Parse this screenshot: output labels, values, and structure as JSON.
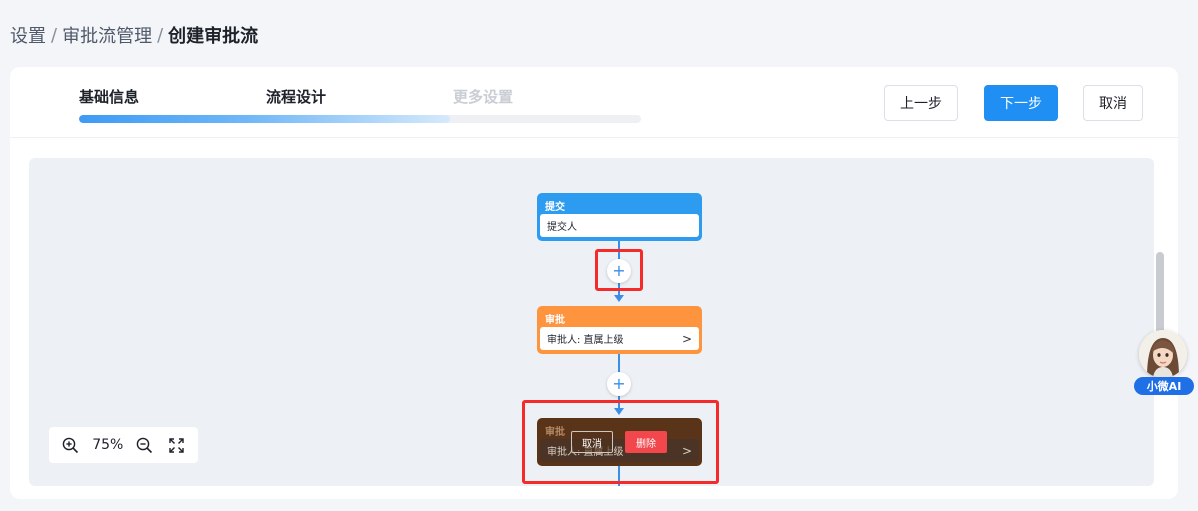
{
  "breadcrumb": {
    "item1": "设置",
    "item2": "审批流管理",
    "current": "创建审批流",
    "separator": "/"
  },
  "steps": [
    {
      "label": "基础信息",
      "state": "done"
    },
    {
      "label": "流程设计",
      "state": "active"
    },
    {
      "label": "更多设置",
      "state": "disabled"
    }
  ],
  "progress": {
    "percent": 66
  },
  "actions": {
    "prev": "上一步",
    "next": "下一步",
    "cancel": "取消"
  },
  "flow": {
    "submit": {
      "title": "提交",
      "body": "提交人"
    },
    "approve": {
      "title": "审批",
      "body": "审批人: 直属上级"
    },
    "approve_selected": {
      "title": "审批",
      "body": "审批人: 直属上级",
      "cancel": "取消",
      "delete": "删除"
    },
    "add_symbol": "+",
    "chevron": ">"
  },
  "zoom": {
    "level": "75%"
  },
  "assistant": {
    "label": "小微AI"
  },
  "colors": {
    "primary": "#1f8ff3",
    "submit_node": "#2d9bf0",
    "approve_node": "#ff943e",
    "danger": "#f2474d",
    "highlight": "#f52a2a"
  }
}
